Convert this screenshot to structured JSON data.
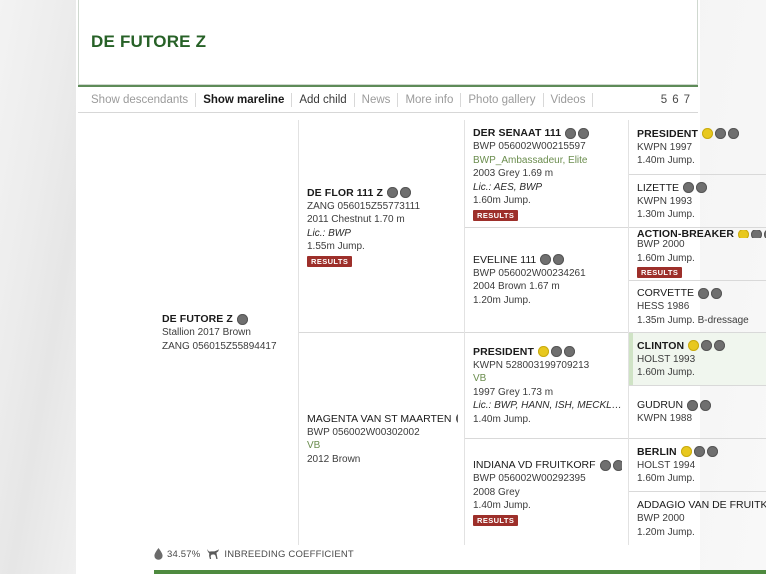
{
  "header": {
    "title": "DE FUTORE Z",
    "title_color": "#276127"
  },
  "tabs": [
    {
      "label": "Show descendants",
      "state": "muted"
    },
    {
      "label": "Show mareline",
      "state": "active"
    },
    {
      "label": "Add child",
      "state": "dark"
    },
    {
      "label": "News",
      "state": "muted"
    },
    {
      "label": "More info",
      "state": "muted"
    },
    {
      "label": "Photo gallery",
      "state": "muted"
    },
    {
      "label": "Videos",
      "state": "muted"
    }
  ],
  "generations": [
    "5",
    "6",
    "7"
  ],
  "pedigree": {
    "subject": {
      "name": "DE FUTORE Z",
      "line1": "Stallion 2017 Brown",
      "line2": "ZANG 056015Z55894417",
      "icons": [
        "edit-icon"
      ]
    },
    "gen1": [
      {
        "name": "DE FLOR 111 Z",
        "bold": true,
        "reg": "ZANG 056015Z55773111",
        "desc": "2011 Chestnut 1.70 m",
        "lic": "Lic.: BWP",
        "perf": "1.55m Jump.",
        "badge": "RESULTS",
        "icons": [
          "pedigree-icon",
          "edit-icon"
        ]
      },
      {
        "name": "MAGENTA VAN ST MAARTEN",
        "bold": false,
        "reg": "BWP 056002W00302002",
        "studbook": "VB",
        "desc": "2012 Brown",
        "icons": [
          "pedigree-icon",
          "edit-icon"
        ]
      }
    ],
    "gen2": [
      {
        "name": "DER SENAAT 111",
        "bold": true,
        "reg": "BWP 056002W00215597",
        "studbook": "BWP_Ambassadeur, Elite",
        "desc": "2003 Grey 1.69 m",
        "lic": "Lic.: AES, BWP",
        "perf": "1.60m Jump.",
        "badge": "RESULTS",
        "icons": [
          "pedigree-icon",
          "edit-icon"
        ]
      },
      {
        "name": "EVELINE 111",
        "bold": false,
        "reg": "BWP 056002W00234261",
        "desc": "2004 Brown 1.67 m",
        "perf": "1.20m Jump.",
        "icons": [
          "pedigree-icon",
          "edit-icon"
        ]
      },
      {
        "name": "PRESIDENT",
        "bold": true,
        "reg": "KWPN 528003199709213",
        "studbook": "VB",
        "desc": "1997 Grey 1.73 m",
        "lic": "Lic.: BWP, HANN, ISH, MECKL, OLDBG,...",
        "perf": "1.40m Jump.",
        "icons": [
          "gold-icon",
          "pedigree-icon",
          "edit-icon"
        ]
      },
      {
        "name": "INDIANA VD FRUITKORF",
        "bold": false,
        "reg": "BWP 056002W00292395",
        "desc": "2008 Grey",
        "perf": "1.40m Jump.",
        "badge": "RESULTS",
        "icons": [
          "pedigree-icon",
          "edit-icon"
        ]
      }
    ],
    "gen3": [
      {
        "name": "PRESIDENT",
        "bold": true,
        "reg": "KWPN 1997",
        "perf": "1.40m Jump.",
        "icons": [
          "gold-icon",
          "pedigree-icon",
          "edit-icon"
        ]
      },
      {
        "name": "LIZETTE",
        "bold": false,
        "reg": "KWPN 1993",
        "perf": "1.30m Jump.",
        "icons": [
          "pedigree-icon",
          "edit-icon"
        ]
      },
      {
        "name": "ACTION-BREAKER",
        "bold": true,
        "reg": "BWP 2000",
        "perf": "1.60m Jump.",
        "badge": "RESULTS",
        "icons": [
          "gold-icon",
          "pedigree-icon",
          "edit-icon"
        ]
      },
      {
        "name": "CORVETTE",
        "bold": false,
        "reg": "HESS 1986",
        "perf": "1.35m Jump. B-dressage",
        "icons": [
          "pedigree-icon",
          "edit-icon"
        ]
      },
      {
        "name": "CLINTON",
        "bold": true,
        "reg": "HOLST 1993",
        "perf": "1.60m Jump.",
        "highlight": true,
        "icons": [
          "gold-icon",
          "pedigree-icon",
          "edit-icon"
        ]
      },
      {
        "name": "GUDRUN",
        "bold": false,
        "reg": "KWPN 1988",
        "icons": [
          "pedigree-icon",
          "edit-icon"
        ]
      },
      {
        "name": "BERLIN",
        "bold": true,
        "reg": "HOLST 1994",
        "perf": "1.60m Jump.",
        "icons": [
          "gold-icon",
          "pedigree-icon",
          "edit-icon"
        ]
      },
      {
        "name": "ADDAGIO VAN DE FRUITKORF",
        "bold": false,
        "reg": "BWP 2000",
        "perf": "1.20m Jump.",
        "icons": [
          "pedigree-icon",
          "edit-icon"
        ]
      }
    ]
  },
  "footer": {
    "percent": "34.57%",
    "label": "INBREEDING COEFFICIENT",
    "drop_icon": "droplet-icon",
    "horse_icon": "horse-icon",
    "bar_color": "#4e8a3f"
  }
}
